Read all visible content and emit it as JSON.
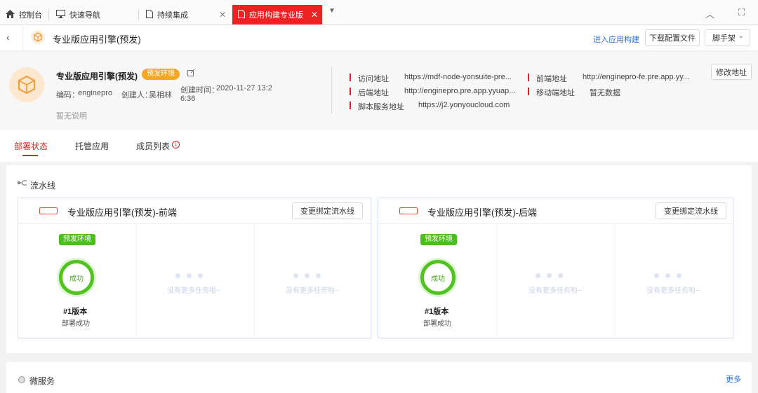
{
  "tabs": [
    {
      "label": "控制台",
      "icon": "home-icon"
    },
    {
      "label": "快速导航",
      "icon": "monitor-icon"
    },
    {
      "label": "持续集成",
      "icon": "document-icon"
    },
    {
      "label": "应用构建专业版",
      "icon": "document-icon",
      "active": true
    }
  ],
  "header": {
    "title": "专业版应用引擎(预发)",
    "enter_build": "进入应用构建",
    "download_config": "下载配置文件",
    "scaffold": "脚手架"
  },
  "app": {
    "name": "专业版应用引擎(预发)",
    "env_badge": "预发环境",
    "code_label": "编码：",
    "code_value": "enginepro",
    "creator_label": "创建人：",
    "creator_value": "吴相林",
    "created_label": "创建时间：",
    "created_value_1": "2020-11-27 13:2",
    "created_value_2": "6:36",
    "description": "暂无说明",
    "modify_address": "修改地址"
  },
  "addresses": [
    {
      "label": "访问地址",
      "value": "https://mdf-node-yonsuite-pre..."
    },
    {
      "label": "前端地址",
      "value": "http://enginepro-fe.pre.app.yy..."
    },
    {
      "label": "后端地址",
      "value": "http://enginepro.pre.app.yyuap..."
    },
    {
      "label": "移动端地址",
      "value": "暂无数据"
    },
    {
      "label": "脚本服务地址",
      "value": "https://j2.yonyoucloud.com"
    }
  ],
  "subtabs": [
    "部署状态",
    "托管应用",
    "成员列表"
  ],
  "pipeline": {
    "title": "流水线",
    "cards": [
      {
        "title": "专业版应用引擎(预发)-前端",
        "button": "变更绑定流水线",
        "env": "预发环境",
        "status": "成功",
        "version": "#1版本",
        "deploy_status": "部署成功",
        "empty_text": "没有更多任务啦~"
      },
      {
        "title": "专业版应用引擎(预发)-后端",
        "button": "变更绑定流水线",
        "env": "预发环境",
        "status": "成功",
        "version": "#1版本",
        "deploy_status": "部署成功",
        "empty_text": "没有更多任务啦~"
      }
    ]
  },
  "micro": {
    "title": "微服务",
    "more": "更多"
  },
  "colors": {
    "brand_red": "#ee2223",
    "success_green": "#4fc31e",
    "badge_orange": "#f5a623",
    "link_blue": "#2a6dd6"
  }
}
